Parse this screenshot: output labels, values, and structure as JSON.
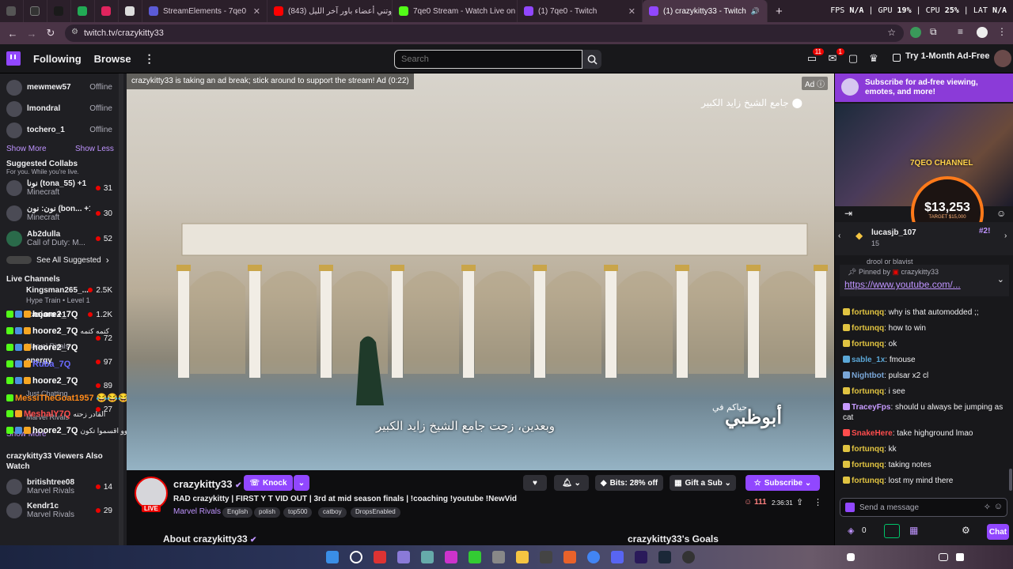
{
  "browser": {
    "tabs": [
      {
        "label": "StreamElements - 7qe0",
        "color": "#5b5bd6"
      },
      {
        "label": "(843) روتني أعضاء باور آخر الليل",
        "color": "#ff0000"
      },
      {
        "label": "7qe0 Stream - Watch Live on Kick",
        "color": "#53fc18"
      },
      {
        "label": "(1) 7qe0 - Twitch",
        "color": "#9147ff"
      },
      {
        "label": "(1) crazykitty33 - Twitch",
        "color": "#9147ff"
      }
    ],
    "new_tab": "+",
    "url": "twitch.tv/crazykitty33",
    "stats": {
      "fps_label": "FPS",
      "fps": "N/A",
      "gpu_label": "GPU",
      "gpu": "19%",
      "cpu_label": "CPU",
      "cpu": "25%",
      "lat_label": "LAT",
      "lat": "N/A"
    }
  },
  "topnav": {
    "following": "Following",
    "browse": "Browse",
    "search_placeholder": "Search",
    "notif_count": "11",
    "inbox_count": "1",
    "adfree": "Try 1-Month Ad-Free"
  },
  "sidebar": {
    "followed": [
      {
        "name": "mewmew57",
        "status": "Offline"
      },
      {
        "name": "lmondral",
        "status": "Offline"
      },
      {
        "name": "tochero_1",
        "status": "Offline"
      }
    ],
    "show_more": "Show More",
    "show_less": "Show Less",
    "collabs_title": "Suggested Collabs",
    "collabs_sub": "For you. While you're live.",
    "collabs": [
      {
        "name": "نونا (tona_55) +1",
        "game": "Minecraft",
        "viewers": "31"
      },
      {
        "name": "نون: نون (bon... +1",
        "game": "Minecraft",
        "viewers": "30"
      },
      {
        "name": "Ab2dulla",
        "game": "Call of Duty: M...",
        "viewers": "52"
      }
    ],
    "see_all": "See All Suggested",
    "live_title": "Live Channels",
    "live": [
      {
        "name": "Kingsman265_...",
        "game": "Hype Train • Level 1",
        "viewers": "2.5K"
      },
      {
        "name": "Raajaro +1",
        "game": "",
        "viewers": "1.2K"
      },
      {
        "name": "",
        "game": "Marvel Rivals",
        "viewers": "72"
      },
      {
        "name": "energy",
        "game": "",
        "viewers": "97"
      },
      {
        "name": "",
        "game": "Just Chatting",
        "viewers": "89"
      },
      {
        "name": "",
        "game": "Marvel Rivals",
        "viewers": "27"
      }
    ],
    "show_more2": "Show More",
    "viewers_title": "crazykitty33 Viewers Also Watch",
    "also": [
      {
        "name": "britishtree08",
        "game": "Marvel Rivals",
        "viewers": "14"
      },
      {
        "name": "Kendr1c",
        "game": "Marvel Rivals",
        "viewers": "29"
      }
    ]
  },
  "overlay_chat": [
    {
      "user": "hoore2_7Q",
      "text": "",
      "color": "#ffffff"
    },
    {
      "user": "hoore2_7Q",
      "text": "كتمه كتمه",
      "color": "#ffffff"
    },
    {
      "user": "hoore2_7Q",
      "text": "",
      "color": "#ffffff"
    },
    {
      "user": "Ruba_7Q",
      "text": "",
      "color": "#6b6bff"
    },
    {
      "user": "hoore2_7Q",
      "text": "",
      "color": "#ffffff"
    },
    {
      "user": "MessiTheGoat1957",
      "text": "😂😂😂",
      "color": "#ff8a1a"
    },
    {
      "user": "MeshalY7Q",
      "text": "القادر زحته",
      "color": "#ff4d4d"
    },
    {
      "user": "hoore2_7Q",
      "text": "وووووووو اقسموا تكون",
      "color": "#ffffff"
    }
  ],
  "video": {
    "ad_text": "crazykitty33 is taking an ad break; stick around to support the stream! Ad (0:22)",
    "ad_tag": "Ad",
    "location": "جامع الشيخ زايد الكبير",
    "subtitle": "وبعدين، زحت جامع الشيخ زايد الكبير",
    "brand_small": "حياكم في",
    "brand": "أبوظبي"
  },
  "channel": {
    "name": "crazykitty33",
    "knock": "Knock",
    "live": "LIVE",
    "bits": "Bits: 28% off",
    "gift": "Gift a Sub",
    "subscribe": "Subscribe",
    "title": "RAD crazykitty | FIRST Y T VID OUT | 3rd at mid season finals | !coaching !youtube !NewVid",
    "game": "Marvel Rivals",
    "tags": [
      "English",
      "polish",
      "top500",
      "catboy",
      "DropsEnabled"
    ],
    "viewers": "111",
    "uptime": "2:36:31",
    "about": "About crazykitty33",
    "goals": "crazykitty33's Goals"
  },
  "rightpanel": {
    "banner": "Subscribe for ad-free viewing, emotes, and more!",
    "overlay_channel": "7QEO CHANNEL",
    "goal_amount": "$13,253",
    "goal_target": "TARGET $15,000",
    "hype_user": "lucasjb_107",
    "hype_count": "15",
    "hype_rank": "#2!",
    "pinned_by": "Pinned by",
    "pinned_user": "crazykitty33",
    "pinned_link": "https://www.youtube.com/...",
    "cut_msg": "drool or blavist",
    "messages": [
      {
        "user": "fortunqq",
        "text": "why is that automodded ;;",
        "color": "#e0c341"
      },
      {
        "user": "fortunqq",
        "text": "how to win",
        "color": "#e0c341"
      },
      {
        "user": "fortunqq",
        "text": "ok",
        "color": "#e0c341"
      },
      {
        "user": "sable_1x",
        "text": "fmouse",
        "color": "#5ba8d8"
      },
      {
        "user": "Nightbot",
        "text": "pulsar x2 cl",
        "color": "#7aa7d8"
      },
      {
        "user": "fortunqq",
        "text": "i see",
        "color": "#e0c341"
      },
      {
        "user": "TraceyFps",
        "text": "should u always be jumping as cat",
        "color": "#c79bff"
      },
      {
        "user": "SnakeHere",
        "text": "take highground lmao",
        "color": "#ff4d4d"
      },
      {
        "user": "fortunqq",
        "text": "kk",
        "color": "#e0c341"
      },
      {
        "user": "fortunqq",
        "text": "taking notes",
        "color": "#e0c341"
      },
      {
        "user": "fortunqq",
        "text": "lost my mind there",
        "color": "#e0c341"
      }
    ],
    "input_placeholder": "Send a message",
    "points": "0",
    "chat_button": "Chat"
  },
  "colors": {
    "accent": "#9147ff",
    "live": "#eb0400",
    "link": "#bf94ff"
  }
}
